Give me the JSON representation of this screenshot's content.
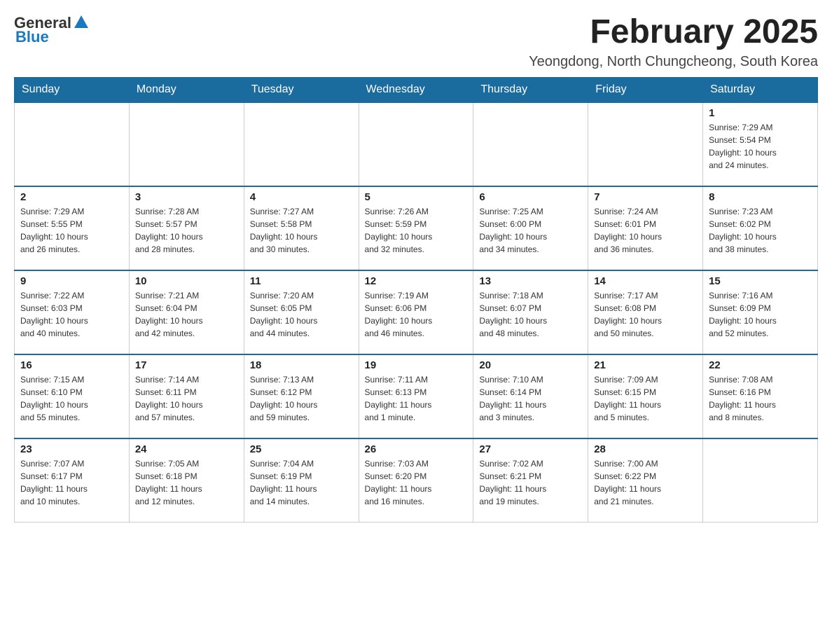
{
  "logo": {
    "text_general": "General",
    "text_blue": "Blue"
  },
  "header": {
    "title": "February 2025",
    "location": "Yeongdong, North Chungcheong, South Korea"
  },
  "days_of_week": [
    "Sunday",
    "Monday",
    "Tuesday",
    "Wednesday",
    "Thursday",
    "Friday",
    "Saturday"
  ],
  "weeks": [
    [
      {
        "day": "",
        "info": ""
      },
      {
        "day": "",
        "info": ""
      },
      {
        "day": "",
        "info": ""
      },
      {
        "day": "",
        "info": ""
      },
      {
        "day": "",
        "info": ""
      },
      {
        "day": "",
        "info": ""
      },
      {
        "day": "1",
        "info": "Sunrise: 7:29 AM\nSunset: 5:54 PM\nDaylight: 10 hours\nand 24 minutes."
      }
    ],
    [
      {
        "day": "2",
        "info": "Sunrise: 7:29 AM\nSunset: 5:55 PM\nDaylight: 10 hours\nand 26 minutes."
      },
      {
        "day": "3",
        "info": "Sunrise: 7:28 AM\nSunset: 5:57 PM\nDaylight: 10 hours\nand 28 minutes."
      },
      {
        "day": "4",
        "info": "Sunrise: 7:27 AM\nSunset: 5:58 PM\nDaylight: 10 hours\nand 30 minutes."
      },
      {
        "day": "5",
        "info": "Sunrise: 7:26 AM\nSunset: 5:59 PM\nDaylight: 10 hours\nand 32 minutes."
      },
      {
        "day": "6",
        "info": "Sunrise: 7:25 AM\nSunset: 6:00 PM\nDaylight: 10 hours\nand 34 minutes."
      },
      {
        "day": "7",
        "info": "Sunrise: 7:24 AM\nSunset: 6:01 PM\nDaylight: 10 hours\nand 36 minutes."
      },
      {
        "day": "8",
        "info": "Sunrise: 7:23 AM\nSunset: 6:02 PM\nDaylight: 10 hours\nand 38 minutes."
      }
    ],
    [
      {
        "day": "9",
        "info": "Sunrise: 7:22 AM\nSunset: 6:03 PM\nDaylight: 10 hours\nand 40 minutes."
      },
      {
        "day": "10",
        "info": "Sunrise: 7:21 AM\nSunset: 6:04 PM\nDaylight: 10 hours\nand 42 minutes."
      },
      {
        "day": "11",
        "info": "Sunrise: 7:20 AM\nSunset: 6:05 PM\nDaylight: 10 hours\nand 44 minutes."
      },
      {
        "day": "12",
        "info": "Sunrise: 7:19 AM\nSunset: 6:06 PM\nDaylight: 10 hours\nand 46 minutes."
      },
      {
        "day": "13",
        "info": "Sunrise: 7:18 AM\nSunset: 6:07 PM\nDaylight: 10 hours\nand 48 minutes."
      },
      {
        "day": "14",
        "info": "Sunrise: 7:17 AM\nSunset: 6:08 PM\nDaylight: 10 hours\nand 50 minutes."
      },
      {
        "day": "15",
        "info": "Sunrise: 7:16 AM\nSunset: 6:09 PM\nDaylight: 10 hours\nand 52 minutes."
      }
    ],
    [
      {
        "day": "16",
        "info": "Sunrise: 7:15 AM\nSunset: 6:10 PM\nDaylight: 10 hours\nand 55 minutes."
      },
      {
        "day": "17",
        "info": "Sunrise: 7:14 AM\nSunset: 6:11 PM\nDaylight: 10 hours\nand 57 minutes."
      },
      {
        "day": "18",
        "info": "Sunrise: 7:13 AM\nSunset: 6:12 PM\nDaylight: 10 hours\nand 59 minutes."
      },
      {
        "day": "19",
        "info": "Sunrise: 7:11 AM\nSunset: 6:13 PM\nDaylight: 11 hours\nand 1 minute."
      },
      {
        "day": "20",
        "info": "Sunrise: 7:10 AM\nSunset: 6:14 PM\nDaylight: 11 hours\nand 3 minutes."
      },
      {
        "day": "21",
        "info": "Sunrise: 7:09 AM\nSunset: 6:15 PM\nDaylight: 11 hours\nand 5 minutes."
      },
      {
        "day": "22",
        "info": "Sunrise: 7:08 AM\nSunset: 6:16 PM\nDaylight: 11 hours\nand 8 minutes."
      }
    ],
    [
      {
        "day": "23",
        "info": "Sunrise: 7:07 AM\nSunset: 6:17 PM\nDaylight: 11 hours\nand 10 minutes."
      },
      {
        "day": "24",
        "info": "Sunrise: 7:05 AM\nSunset: 6:18 PM\nDaylight: 11 hours\nand 12 minutes."
      },
      {
        "day": "25",
        "info": "Sunrise: 7:04 AM\nSunset: 6:19 PM\nDaylight: 11 hours\nand 14 minutes."
      },
      {
        "day": "26",
        "info": "Sunrise: 7:03 AM\nSunset: 6:20 PM\nDaylight: 11 hours\nand 16 minutes."
      },
      {
        "day": "27",
        "info": "Sunrise: 7:02 AM\nSunset: 6:21 PM\nDaylight: 11 hours\nand 19 minutes."
      },
      {
        "day": "28",
        "info": "Sunrise: 7:00 AM\nSunset: 6:22 PM\nDaylight: 11 hours\nand 21 minutes."
      },
      {
        "day": "",
        "info": ""
      }
    ]
  ]
}
